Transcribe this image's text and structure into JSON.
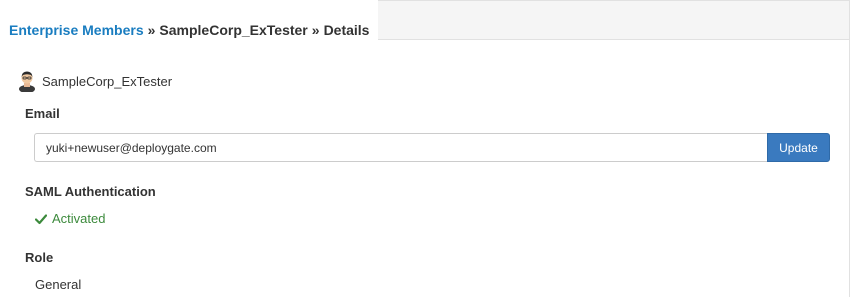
{
  "breadcrumb": {
    "root": "Enterprise Members",
    "separator": "»",
    "member": "SampleCorp_ExTester",
    "current": "Details"
  },
  "member": {
    "name": "SampleCorp_ExTester",
    "avatar_icon": "user-avatar-icon"
  },
  "email": {
    "title": "Email",
    "value": "yuki+newuser@deploygate.com",
    "button_label": "Update"
  },
  "saml": {
    "title": "SAML Authentication",
    "status": "Activated",
    "status_icon": "check-icon",
    "status_color": "#3c8a3c"
  },
  "role": {
    "title": "Role",
    "value": "General"
  },
  "colors": {
    "link": "#1a7dc0",
    "primary_button": "#3a7abf"
  }
}
